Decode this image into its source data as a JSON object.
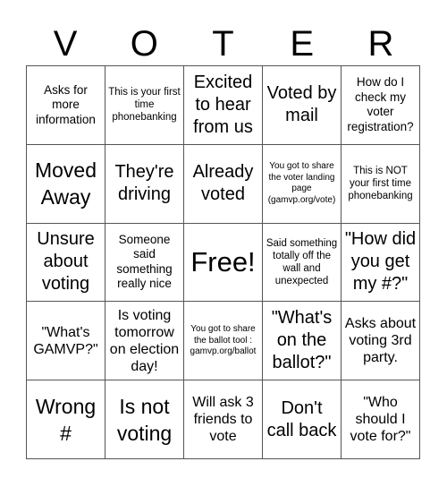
{
  "header": {
    "letters": [
      "V",
      "O",
      "T",
      "E",
      "R"
    ]
  },
  "board": {
    "rows": [
      [
        {
          "text": "Asks for more information"
        },
        {
          "text": "This is your first time phonebanking"
        },
        {
          "text": "Excited to hear from us"
        },
        {
          "text": "Voted by mail"
        },
        {
          "text": "How do I check my voter registration?"
        }
      ],
      [
        {
          "text": "Moved Away"
        },
        {
          "text": "They're driving"
        },
        {
          "text": "Already voted"
        },
        {
          "text": "You got to share the voter landing page (gamvp.org/vote)"
        },
        {
          "text": "This is NOT your first time phonebanking"
        }
      ],
      [
        {
          "text": "Unsure about voting"
        },
        {
          "text": "Someone said something really nice"
        },
        {
          "text": "Free!"
        },
        {
          "text": "Said something totally off the wall and unexpected"
        },
        {
          "text": "\"How did you get my #?\""
        }
      ],
      [
        {
          "text": "\"What's GAMVP?\""
        },
        {
          "text": "Is voting tomorrow on election day!"
        },
        {
          "text": "You got to share the ballot tool : gamvp.org/ballot"
        },
        {
          "text": "\"What's on the ballot?\""
        },
        {
          "text": "Asks about voting 3rd party."
        }
      ],
      [
        {
          "text": "Wrong #"
        },
        {
          "text": "Is not voting"
        },
        {
          "text": "Will ask 3 friends to vote"
        },
        {
          "text": "Don't call back"
        },
        {
          "text": "\"Who should I vote for?\""
        }
      ]
    ]
  }
}
